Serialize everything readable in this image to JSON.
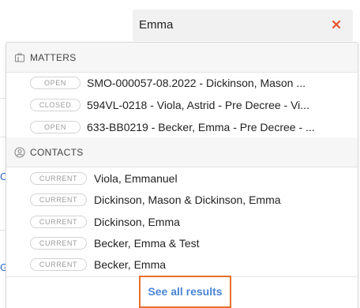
{
  "search": {
    "value": "Emma"
  },
  "background": {
    "fragment_c": "C",
    "fragment_g": "G"
  },
  "dropdown": {
    "matters": {
      "label": "MATTERS",
      "items": [
        {
          "status": "OPEN",
          "text": "SMO-000057-08.2022 - Dickinson, Mason ..."
        },
        {
          "status": "CLOSED",
          "text": "594VL-0218 - Viola, Astrid - Pre Decree - Vi..."
        },
        {
          "status": "OPEN",
          "text": "633-BB0219 - Becker, Emma - Pre Decree - ..."
        }
      ]
    },
    "contacts": {
      "label": "CONTACTS",
      "items": [
        {
          "status": "CURRENT",
          "text": "Viola, Emmanuel"
        },
        {
          "status": "CURRENT",
          "text": "Dickinson, Mason & Dickinson, Emma"
        },
        {
          "status": "CURRENT",
          "text": "Dickinson, Emma"
        },
        {
          "status": "CURRENT",
          "text": "Becker, Emma & Test"
        },
        {
          "status": "CURRENT",
          "text": "Becker, Emma"
        }
      ]
    },
    "see_all_label": "See all results"
  },
  "colors": {
    "accent_orange": "#e8702a",
    "link_blue": "#4a86d8",
    "clear_red": "#e5532d"
  }
}
